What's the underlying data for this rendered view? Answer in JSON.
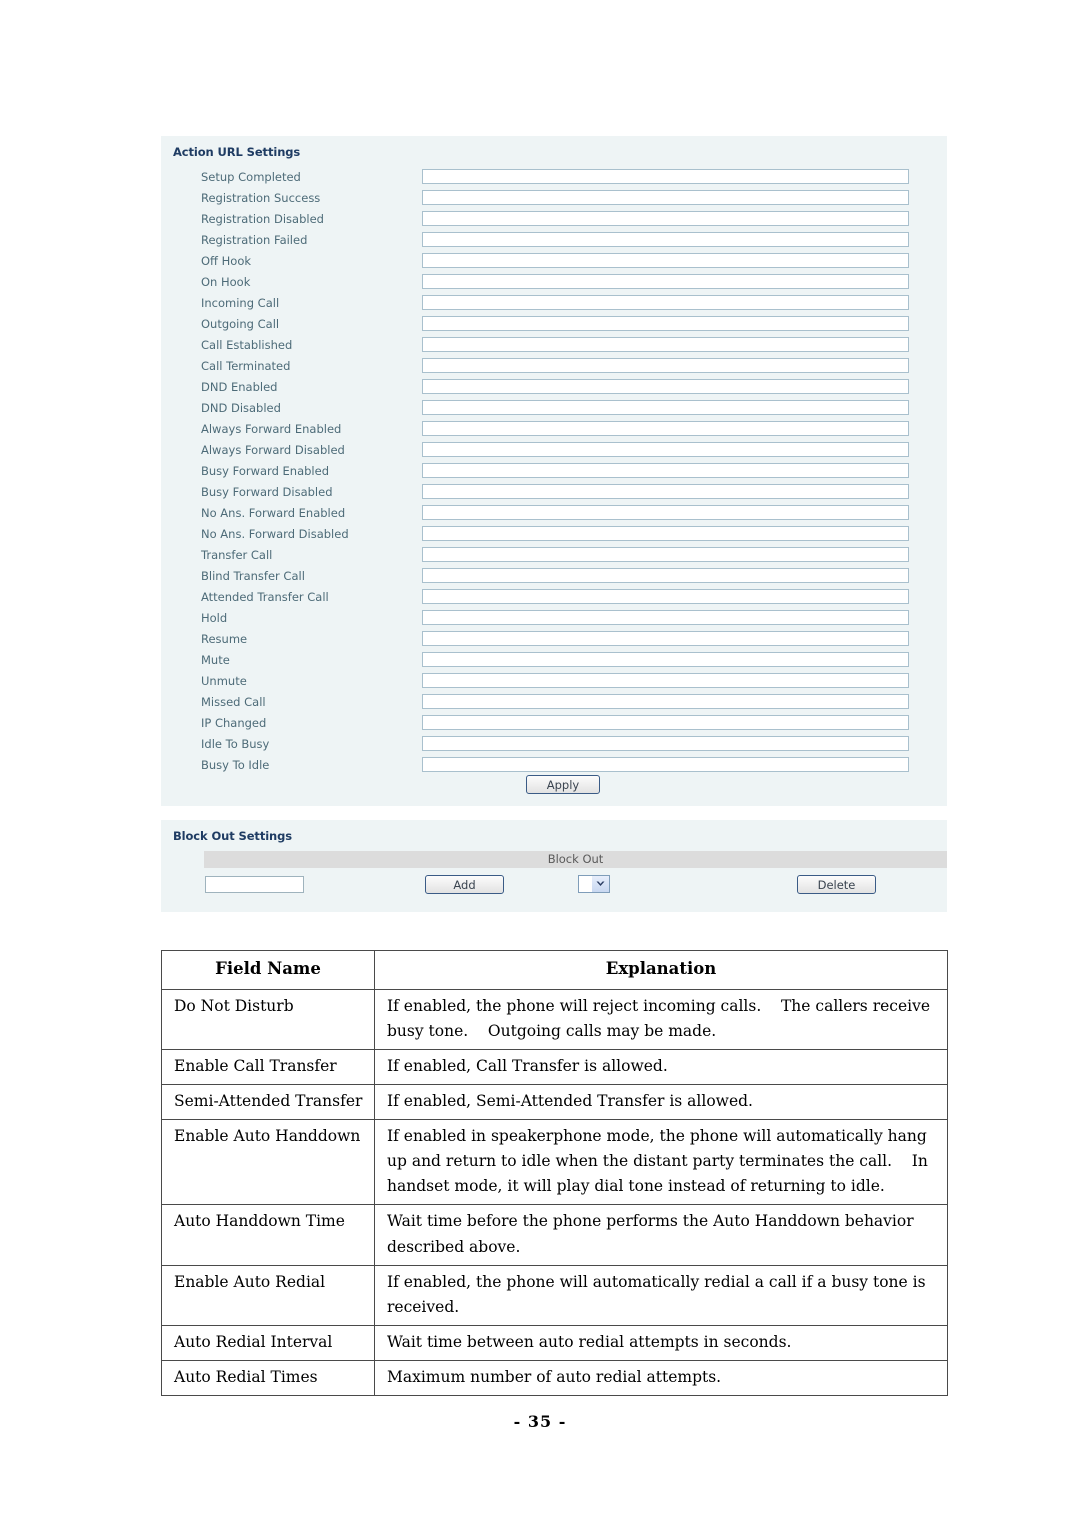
{
  "colors": {
    "panel_bg": "#eef4f5",
    "label_text": "#4d6b78",
    "title_text": "#1f3c63",
    "input_border": "#a9c0cd",
    "header_strip": "#dcdcdc"
  },
  "action_url_panel": {
    "title": "Action URL Settings",
    "rows": [
      {
        "label": "Setup Completed",
        "value": ""
      },
      {
        "label": "Registration Success",
        "value": ""
      },
      {
        "label": "Registration Disabled",
        "value": ""
      },
      {
        "label": "Registration Failed",
        "value": ""
      },
      {
        "label": "Off Hook",
        "value": ""
      },
      {
        "label": "On Hook",
        "value": ""
      },
      {
        "label": "Incoming Call",
        "value": ""
      },
      {
        "label": "Outgoing Call",
        "value": ""
      },
      {
        "label": "Call Established",
        "value": ""
      },
      {
        "label": "Call Terminated",
        "value": ""
      },
      {
        "label": "DND Enabled",
        "value": ""
      },
      {
        "label": "DND Disabled",
        "value": ""
      },
      {
        "label": "Always Forward Enabled",
        "value": ""
      },
      {
        "label": "Always Forward Disabled",
        "value": ""
      },
      {
        "label": "Busy Forward Enabled",
        "value": ""
      },
      {
        "label": "Busy Forward Disabled",
        "value": ""
      },
      {
        "label": "No Ans. Forward Enabled",
        "value": ""
      },
      {
        "label": "No Ans. Forward Disabled",
        "value": ""
      },
      {
        "label": "Transfer Call",
        "value": ""
      },
      {
        "label": "Blind Transfer Call",
        "value": ""
      },
      {
        "label": "Attended Transfer Call",
        "value": ""
      },
      {
        "label": "Hold",
        "value": ""
      },
      {
        "label": "Resume",
        "value": ""
      },
      {
        "label": "Mute",
        "value": ""
      },
      {
        "label": "Unmute",
        "value": ""
      },
      {
        "label": "Missed Call",
        "value": ""
      },
      {
        "label": "IP Changed",
        "value": ""
      },
      {
        "label": "Idle To Busy",
        "value": ""
      },
      {
        "label": "Busy To Idle",
        "value": ""
      }
    ],
    "apply_label": "Apply"
  },
  "block_out_panel": {
    "title": "Block Out Settings",
    "column_header": "Block Out",
    "input_value": "",
    "add_label": "Add",
    "delete_label": "Delete",
    "select_value": "",
    "select_icon": "chevron-down-icon"
  },
  "explanation_table": {
    "headers": [
      "Field Name",
      "Explanation"
    ],
    "rows": [
      {
        "field": "Do Not Disturb",
        "explanation": "If enabled, the phone will reject incoming calls.    The callers receive busy tone.    Outgoing calls may be made."
      },
      {
        "field": "Enable Call Transfer",
        "explanation": "If enabled, Call Transfer is allowed."
      },
      {
        "field": "Semi-Attended Transfer",
        "explanation": "If enabled, Semi-Attended Transfer is allowed."
      },
      {
        "field": "Enable Auto Handdown",
        "explanation": "If enabled in speakerphone mode, the phone will automatically hang up and return to idle when the distant party terminates the call.    In handset mode, it will play dial tone instead of returning to idle."
      },
      {
        "field": "Auto Handdown Time",
        "explanation": "Wait time before the phone performs the Auto Handdown behavior described above."
      },
      {
        "field": "Enable Auto Redial",
        "explanation": "If enabled, the phone will automatically redial a call if a busy tone is received."
      },
      {
        "field": "Auto Redial Interval",
        "explanation": "Wait time between auto redial attempts in seconds."
      },
      {
        "field": "Auto Redial Times",
        "explanation": "Maximum number of auto redial attempts."
      }
    ]
  },
  "footer": {
    "page_number": "- 35 -"
  }
}
